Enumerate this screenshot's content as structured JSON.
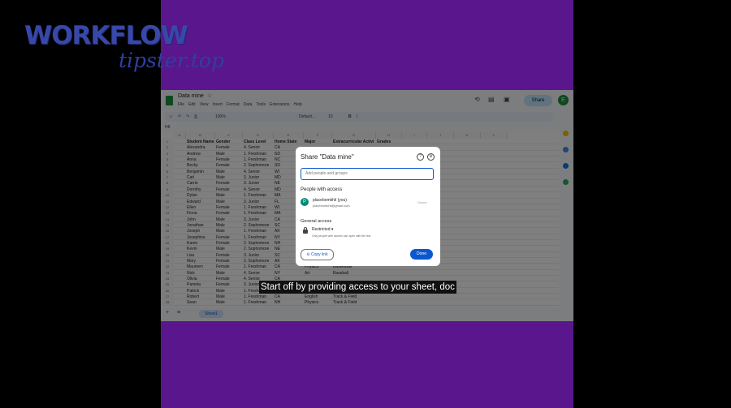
{
  "brand": {
    "word1": "WORKFLOW",
    "word2": "tipster.top"
  },
  "sheets": {
    "doc_title": "Data mine",
    "menu": [
      "File",
      "Edit",
      "View",
      "Insert",
      "Format",
      "Data",
      "Tools",
      "Extensions",
      "Help"
    ],
    "share_label": "Share",
    "avatar_letter": "E",
    "toolbar": {
      "zoom": "100%",
      "font": "Default...",
      "size": "10"
    },
    "cell_ref": "H8",
    "col_letters": [
      "A",
      "B",
      "C",
      "D",
      "E",
      "F",
      "G",
      "H",
      "I",
      "J",
      "K",
      "L"
    ],
    "headers": [
      "Student Name",
      "Gender",
      "Class Level",
      "Home State",
      "Major",
      "Extracurricular Activity",
      "Grades"
    ],
    "rows": [
      [
        "Alexandra",
        "Female",
        "4. Senior",
        "CA",
        "",
        "",
        ""
      ],
      [
        "Andrew",
        "Male",
        "1. Freshman",
        "SD",
        "",
        "",
        ""
      ],
      [
        "Anna",
        "Female",
        "1. Freshman",
        "NC",
        "",
        "",
        ""
      ],
      [
        "Becky",
        "Female",
        "2. Sophomore",
        "SD",
        "",
        "",
        ""
      ],
      [
        "Benjamin",
        "Male",
        "4. Senior",
        "WI",
        "",
        "",
        ""
      ],
      [
        "Carl",
        "Male",
        "3. Junior",
        "MD",
        "",
        "",
        ""
      ],
      [
        "Carrie",
        "Female",
        "3. Junior",
        "NE",
        "",
        "",
        ""
      ],
      [
        "Dorothy",
        "Female",
        "4. Senior",
        "MD",
        "",
        "",
        ""
      ],
      [
        "Dylan",
        "Male",
        "1. Freshman",
        "MA",
        "",
        "",
        ""
      ],
      [
        "Edward",
        "Male",
        "3. Junior",
        "FL",
        "",
        "",
        ""
      ],
      [
        "Ellen",
        "Female",
        "1. Freshman",
        "WI",
        "",
        "",
        ""
      ],
      [
        "Fiona",
        "Female",
        "1. Freshman",
        "MA",
        "",
        "",
        ""
      ],
      [
        "John",
        "Male",
        "3. Junior",
        "CA",
        "",
        "",
        ""
      ],
      [
        "Jonathan",
        "Male",
        "2. Sophomore",
        "SC",
        "",
        "",
        ""
      ],
      [
        "Joseph",
        "Male",
        "1. Freshman",
        "AK",
        "",
        "",
        ""
      ],
      [
        "Josephine",
        "Female",
        "1. Freshman",
        "NY",
        "",
        "",
        ""
      ],
      [
        "Karen",
        "Female",
        "2. Sophomore",
        "NH",
        "",
        "",
        ""
      ],
      [
        "Kevin",
        "Male",
        "2. Sophomore",
        "NE",
        "",
        "",
        ""
      ],
      [
        "Lisa",
        "Female",
        "3. Junior",
        "SC",
        "",
        "",
        ""
      ],
      [
        "Mary",
        "Female",
        "2. Sophomore",
        "AK",
        "",
        "",
        ""
      ],
      [
        "Maureen",
        "Female",
        "1. Freshman",
        "CA",
        "Physics",
        "Basketball",
        ""
      ],
      [
        "Nick",
        "Male",
        "4. Senior",
        "NY",
        "Art",
        "Baseball",
        ""
      ],
      [
        "Olivia",
        "Female",
        "4. Senior",
        "CA",
        "",
        "",
        ""
      ],
      [
        "Pamela",
        "Female",
        "3. Junior",
        "",
        "",
        "",
        ""
      ],
      [
        "Patrick",
        "Male",
        "1. Freshman",
        "",
        "",
        "",
        ""
      ],
      [
        "Robert",
        "Male",
        "1. Freshman",
        "CA",
        "English",
        "Track & Field",
        ""
      ],
      [
        "Sean",
        "Male",
        "1. Freshman",
        "NH",
        "Physics",
        "Track & Field",
        ""
      ]
    ],
    "sheet_tab": "Sheet1"
  },
  "dialog": {
    "title": "Share \"Data mine\"",
    "input_placeholder": "Add people and groups",
    "people_heading": "People with access",
    "person_initial": "P",
    "person_name": "placebomkhil (you)",
    "person_email": "placebomkhil@gmail.com",
    "owner_label": "Owner",
    "general_heading": "General access",
    "access_level": "Restricted",
    "access_desc": "Only people with access can open with the link",
    "copy_link": "Copy link",
    "done": "Done"
  },
  "caption": "Start off by providing access to your sheet, doc",
  "colors": {
    "purple": "#5a168c",
    "accent": "#0b57d0",
    "green": "#1e8e3e"
  }
}
